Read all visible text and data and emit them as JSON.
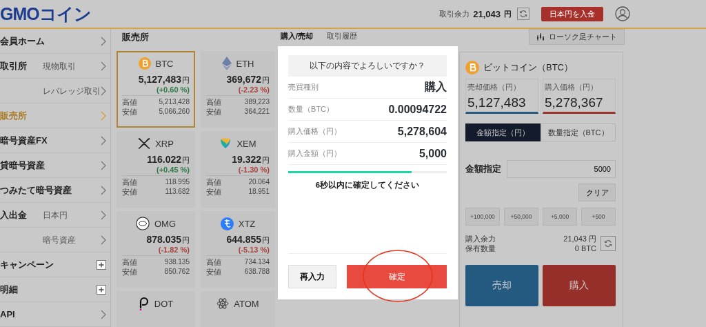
{
  "header": {
    "logo": "GMOコイン",
    "balance_label": "取引余力",
    "balance": "21,043",
    "balance_unit": "円",
    "deposit_button": "日本円を入金"
  },
  "sidebar": {
    "items": [
      {
        "label": "会員ホーム",
        "kind": "link",
        "selected": false
      },
      {
        "label": "取引所",
        "kind": "link",
        "selected": false,
        "children": [
          {
            "label": "現物取引",
            "selected": false
          },
          {
            "label": "レバレッジ取引",
            "selected": false
          }
        ]
      },
      {
        "label": "販売所",
        "kind": "link",
        "selected": true
      },
      {
        "label": "暗号資産FX",
        "kind": "link",
        "selected": false
      },
      {
        "label": "貸暗号資産",
        "kind": "link",
        "selected": false
      },
      {
        "label": "つみたて暗号資産",
        "kind": "link",
        "selected": false
      },
      {
        "label": "入出金",
        "kind": "link",
        "selected": false,
        "children": [
          {
            "label": "日本円",
            "selected": false
          },
          {
            "label": "暗号資産",
            "selected": false
          }
        ]
      },
      {
        "label": "キャンペーン",
        "kind": "expand",
        "selected": false
      },
      {
        "label": "明細",
        "kind": "expand",
        "selected": false
      },
      {
        "label": "API",
        "kind": "link",
        "selected": false
      }
    ]
  },
  "main": {
    "title": "販売所",
    "tabs": [
      {
        "label": "購入/売却",
        "selected": true
      },
      {
        "label": "取引履歴",
        "selected": false
      }
    ],
    "coins": [
      {
        "symbol": "BTC",
        "selected": true,
        "price": "5,127,483",
        "unit": "円",
        "change": "(+0.60 %)",
        "color": "#2e7a47",
        "high_label": "高値",
        "high": "5,213,428",
        "low_label": "安値",
        "low": "5,066,260"
      },
      {
        "symbol": "ETH",
        "selected": false,
        "price": "369,672",
        "unit": "円",
        "change": "(-2.23 %)",
        "color": "#a8423c",
        "high_label": "高値",
        "high": "389,223",
        "low_label": "安値",
        "low": "364,221"
      },
      {
        "symbol": "XRP",
        "selected": false,
        "price": "116.022",
        "unit": "円",
        "change": "(+0.45 %)",
        "color": "#2e7a47",
        "high_label": "高値",
        "high": "118.995",
        "low_label": "安値",
        "low": "113.682"
      },
      {
        "symbol": "XEM",
        "selected": false,
        "price": "19.322",
        "unit": "円",
        "change": "(-1.30 %)",
        "color": "#a8423c",
        "high_label": "高値",
        "high": "20.064",
        "low_label": "安値",
        "low": "18.951"
      },
      {
        "symbol": "OMG",
        "selected": false,
        "price": "878.035",
        "unit": "円",
        "change": "(-1.82 %)",
        "color": "#a8423c",
        "high_label": "高値",
        "high": "938.135",
        "low_label": "安値",
        "low": "850.762"
      },
      {
        "symbol": "XTZ",
        "selected": false,
        "price": "644.855",
        "unit": "円",
        "change": "(-5.13 %)",
        "color": "#a8423c",
        "high_label": "高値",
        "high": "734.134",
        "low_label": "安値",
        "low": "638.788"
      },
      {
        "symbol": "DOT",
        "selected": false
      },
      {
        "symbol": "ATOM",
        "selected": false
      }
    ]
  },
  "order_panel": {
    "chart_button": "ローソク足チャート",
    "coin_title": "ビットコイン（BTC）",
    "prices": [
      {
        "label": "売却価格（円）",
        "value": "5,127,483",
        "color": "#255a80"
      },
      {
        "label": "購入価格（円）",
        "value": "5,278,367",
        "color": "#9c332d"
      }
    ],
    "mode_tabs": [
      {
        "label": "金額指定（円）",
        "selected": true
      },
      {
        "label": "数量指定（BTC）",
        "selected": false
      }
    ],
    "amount_label": "金額指定",
    "amount_value": "5000",
    "clear_button": "クリア",
    "quick_buttons": [
      "+100,000",
      "+50,000",
      "+5,000",
      "+500"
    ],
    "balances": [
      {
        "label": "購入余力",
        "value": "21,043 円"
      },
      {
        "label": "保有数量",
        "value": "0 BTC"
      }
    ],
    "sell_button": "売却",
    "buy_button": "購入"
  },
  "dialog": {
    "question": "以下の内容でよろしいですか？",
    "rows": [
      {
        "label": "売買種別",
        "value": "購入"
      },
      {
        "label": "数量（BTC）",
        "value": "0.00094722"
      },
      {
        "label": "購入価格（円）",
        "value": "5,278,604"
      },
      {
        "label": "購入金額（円）",
        "value": "5,000"
      }
    ],
    "timer": {
      "level": 0.78
    },
    "countdown": "6秒以内に確定してください",
    "cancel_button": "再入力",
    "confirm_button": "確定"
  }
}
